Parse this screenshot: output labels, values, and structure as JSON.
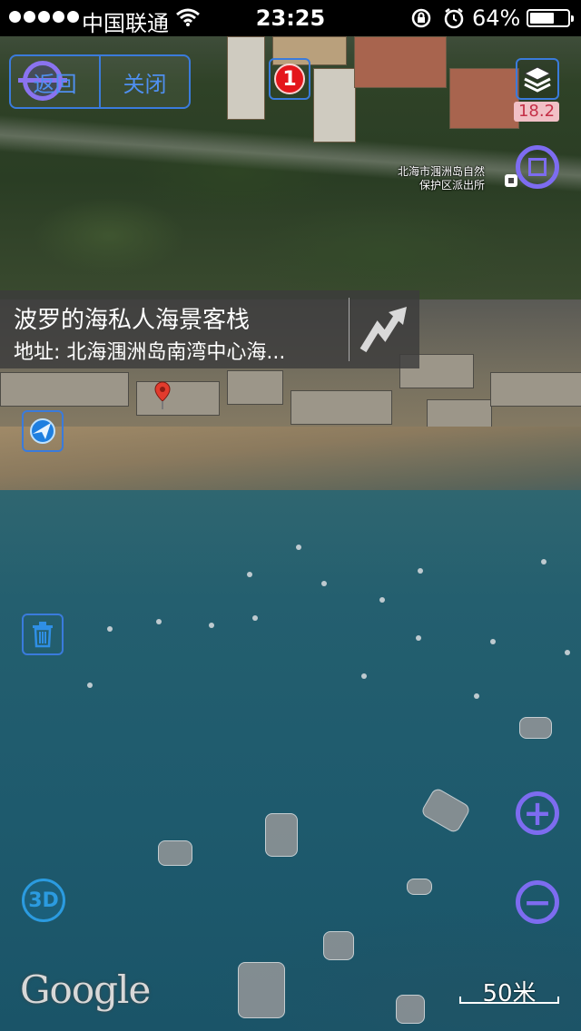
{
  "status_bar": {
    "signal_dots": 5,
    "carrier": "中国联通",
    "time": "23:25",
    "battery_percent_label": "64%",
    "battery_level": 0.64
  },
  "toolbar": {
    "back_label": "返回",
    "close_label": "关闭",
    "notification_count": "1"
  },
  "map": {
    "zoom_level": "18.2",
    "poi_label_line1": "北海市涠洲岛自然",
    "poi_label_line2": "保护区派出所",
    "scale_label": "50米",
    "provider_logo": "Google"
  },
  "info_card": {
    "title": "波罗的海私人海景客栈",
    "address": "地址: 北海涠洲岛南湾中心海..."
  },
  "controls": {
    "mode_3d_label": "3D",
    "zoom_in_label": "+",
    "zoom_out_label": "−"
  },
  "colors": {
    "accent_blue": "#3a7bdc",
    "accent_purple": "#7d6cf0",
    "badge_red": "#e4161c",
    "zoom_badge_bg": "#f1c0c6"
  },
  "icons": {
    "layers": "layers-icon",
    "compass": "compass-icon",
    "locate": "locate-icon",
    "trash": "trash-icon",
    "route": "route-arrow-icon",
    "pin": "map-pin-icon"
  }
}
